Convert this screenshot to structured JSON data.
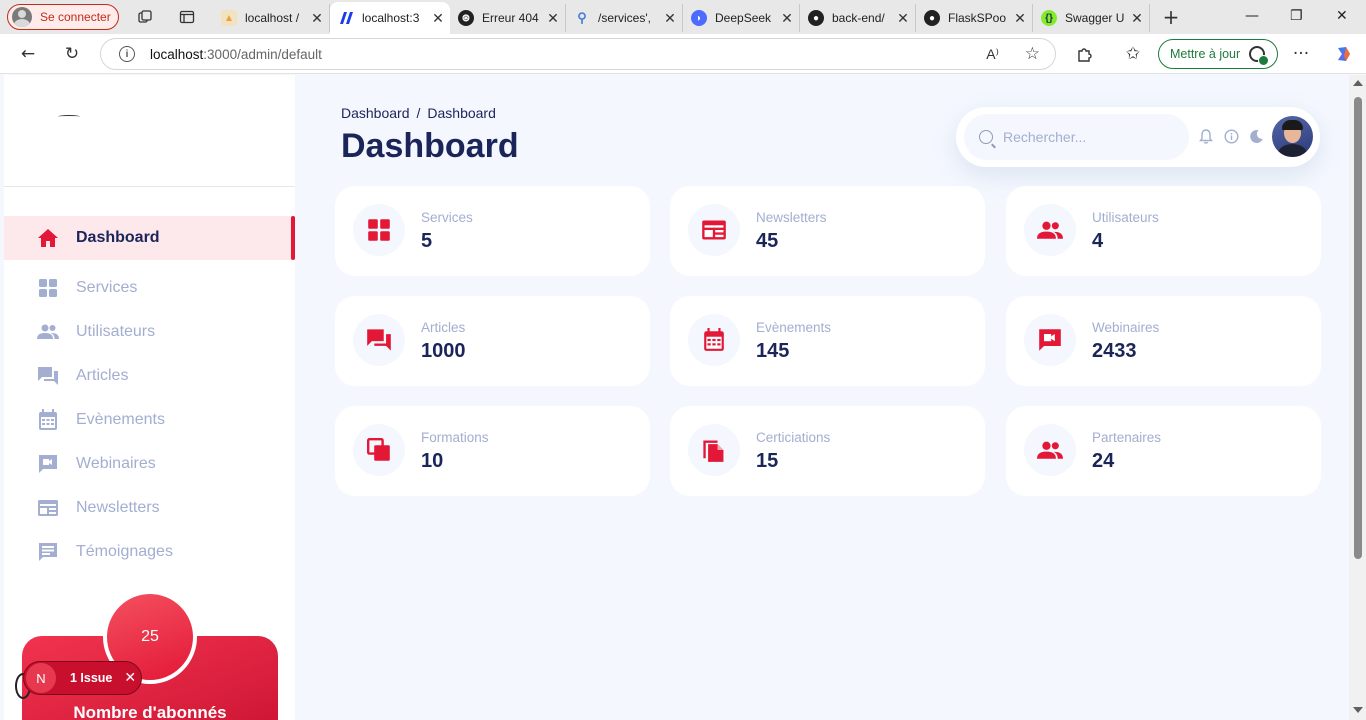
{
  "browser": {
    "profile_label": "Se connecter",
    "tabs": [
      {
        "label": "localhost /",
        "color": "#e6a23c",
        "active": false
      },
      {
        "label": "localhost:3",
        "color": "#1a3cf0",
        "active": true
      },
      {
        "label": "Erreur 404",
        "color": "#222222",
        "active": false
      },
      {
        "label": "/services',",
        "color": "#4a7fd6",
        "active": false
      },
      {
        "label": "DeepSeek",
        "color": "#4d6bfe",
        "active": false
      },
      {
        "label": "back-end/",
        "color": "#222222",
        "active": false
      },
      {
        "label": "FlaskSPoo",
        "color": "#222222",
        "active": false
      },
      {
        "label": "Swagger U",
        "color": "#85ea2d",
        "active": false
      }
    ],
    "url_host": "localhost",
    "url_path": ":3000/admin/default",
    "update_label": "Mettre à jour"
  },
  "sidebar": {
    "items": [
      {
        "label": "Dashboard",
        "icon": "home-icon",
        "active": true
      },
      {
        "label": "Services",
        "icon": "grid-icon"
      },
      {
        "label": "Utilisateurs",
        "icon": "users-icon"
      },
      {
        "label": "Articles",
        "icon": "forum-icon"
      },
      {
        "label": "Evènements",
        "icon": "calendar-icon"
      },
      {
        "label": "Webinaires",
        "icon": "video-chat-icon"
      },
      {
        "label": "Newsletters",
        "icon": "newsletter-icon"
      },
      {
        "label": "Témoignages",
        "icon": "comment-icon"
      }
    ],
    "promo": {
      "count": "25",
      "title": "Nombre d'abonnés"
    },
    "issue_badge": {
      "label": "1 Issue",
      "logo": "N"
    }
  },
  "header": {
    "breadcrumb_root": "Dashboard",
    "breadcrumb_sep": "/",
    "breadcrumb_current": "Dashboard",
    "title": "Dashboard",
    "search_placeholder": "Rechercher..."
  },
  "stats": [
    {
      "label": "Services",
      "value": "5",
      "icon": "grid-icon"
    },
    {
      "label": "Newsletters",
      "value": "45",
      "icon": "newsletter-icon"
    },
    {
      "label": "Utilisateurs",
      "value": "4",
      "icon": "users-icon"
    },
    {
      "label": "Articles",
      "value": "1000",
      "icon": "forum-icon"
    },
    {
      "label": "Evènements",
      "value": "145",
      "icon": "calendar-icon"
    },
    {
      "label": "Webinaires",
      "value": "2433",
      "icon": "video-chat-icon"
    },
    {
      "label": "Formations",
      "value": "10",
      "icon": "copies-icon"
    },
    {
      "label": "Certiciations",
      "value": "15",
      "icon": "file-copy-icon"
    },
    {
      "label": "Partenaires",
      "value": "24",
      "icon": "users-icon"
    }
  ],
  "colors": {
    "brand": "#e31837",
    "text_dark": "#1b2559",
    "text_muted": "#a3aed0",
    "background": "#f4f7fe"
  }
}
